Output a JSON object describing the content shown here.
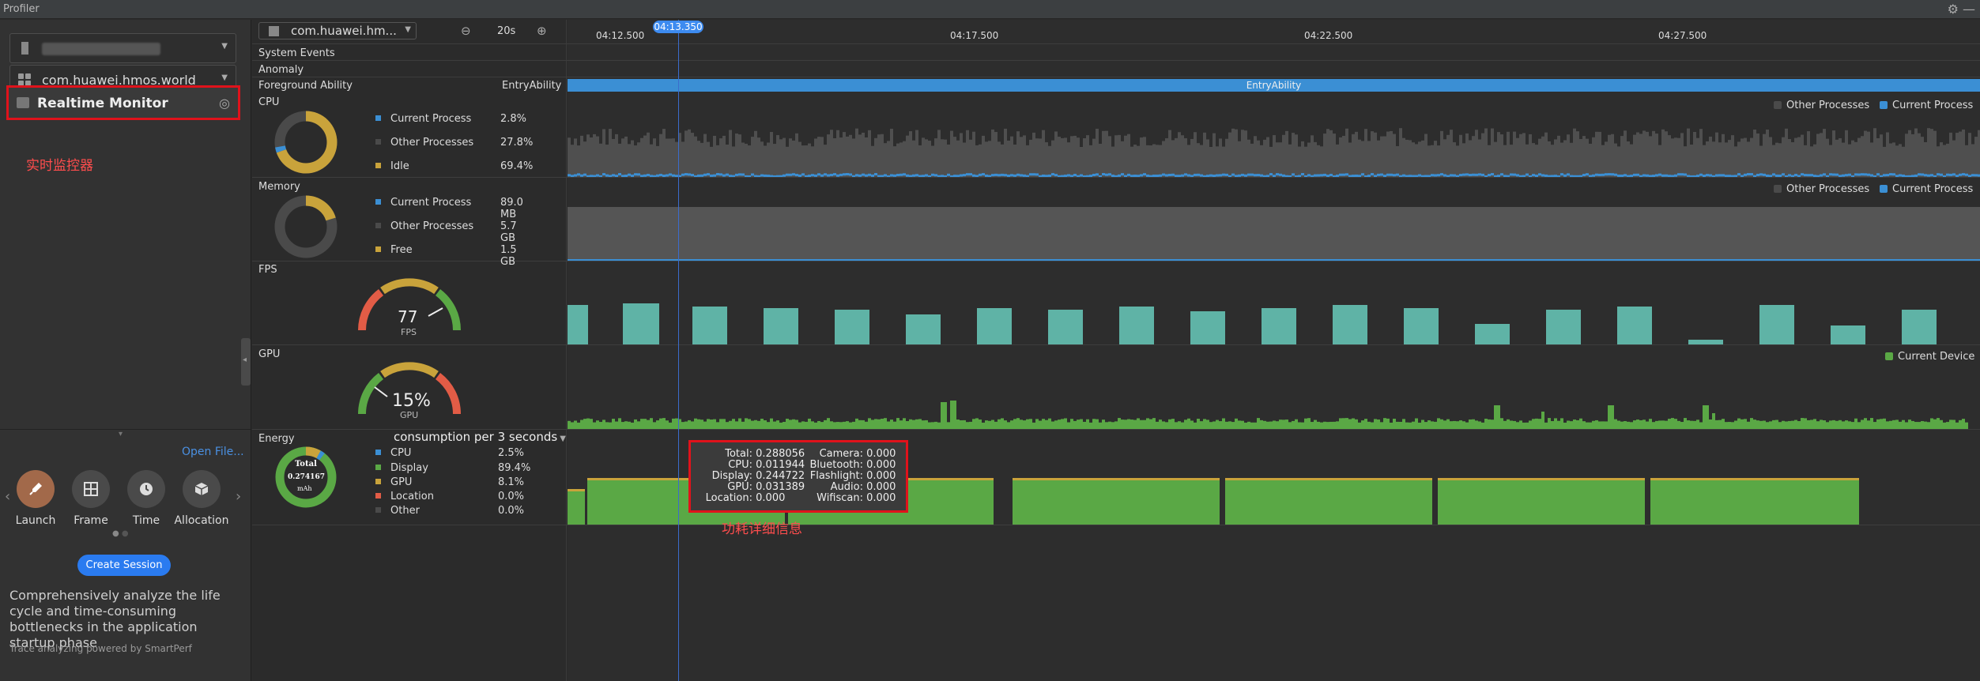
{
  "app": {
    "title": "Profiler"
  },
  "sidebar": {
    "device_select": {
      "value": ""
    },
    "app_select": {
      "value": "com.huawei.hmos.world"
    },
    "realtime_monitor": {
      "label": "Realtime Monitor"
    },
    "annotation_realtime": "实时监控器",
    "open_file": "Open File...",
    "tools": [
      {
        "label": "Launch",
        "icon": "rocket-icon"
      },
      {
        "label": "Frame",
        "icon": "frame-icon"
      },
      {
        "label": "Time",
        "icon": "clock-icon"
      },
      {
        "label": "Allocation",
        "icon": "cube-icon"
      }
    ],
    "create_session": "Create Session",
    "description": "Comprehensively analyze the life cycle and time-consuming bottlenecks in the application startup phase",
    "powered_by": "Trace analyzing powered by SmartPerf"
  },
  "toolbar": {
    "process_select": "com.huawei.hm...",
    "interval": "20s"
  },
  "timeline": {
    "cursor_time": "04:13.350",
    "ticks": [
      "04:12.500",
      "04:17.500",
      "04:22.500",
      "04:27.500"
    ]
  },
  "rows": {
    "system_events": "System Events",
    "anomaly": "Anomaly",
    "foreground_ability": "Foreground Ability",
    "foreground_ability_value": "EntryAbility",
    "foreground_band_label": "EntryAbility"
  },
  "cpu": {
    "title": "CPU",
    "legend": [
      {
        "name": "Current Process",
        "value": "2.8%",
        "color": "#3b8fd4"
      },
      {
        "name": "Other Processes",
        "value": "27.8%",
        "color": "#4a4a4a"
      },
      {
        "name": "Idle",
        "value": "69.4%",
        "color": "#c9a33b"
      }
    ],
    "top_legend": [
      {
        "name": "Other Processes",
        "color": "#4a4a4a"
      },
      {
        "name": "Current Process",
        "color": "#3b8fd4"
      }
    ]
  },
  "memory": {
    "title": "Memory",
    "legend": [
      {
        "name": "Current Process",
        "value": "89.0 MB",
        "color": "#3b8fd4"
      },
      {
        "name": "Other Processes",
        "value": "5.7 GB",
        "color": "#4a4a4a"
      },
      {
        "name": "Free",
        "value": "1.5 GB",
        "color": "#c9a33b"
      }
    ],
    "top_legend": [
      {
        "name": "Other Processes",
        "color": "#4a4a4a"
      },
      {
        "name": "Current Process",
        "color": "#3b8fd4"
      }
    ]
  },
  "fps": {
    "title": "FPS",
    "value": "77",
    "unit": "FPS",
    "gauge_fraction": 0.64
  },
  "gpu": {
    "title": "GPU",
    "value": "15%",
    "unit": "GPU",
    "gauge_fraction": 0.15,
    "top_legend": "Current Device"
  },
  "energy": {
    "title": "Energy",
    "mode": "consumption per 3 seconds",
    "donut_title": "Total",
    "donut_value": "0.274167",
    "donut_unit": "mAh",
    "legend": [
      {
        "name": "CPU",
        "value": "2.5%",
        "color": "#3b8fd4"
      },
      {
        "name": "Display",
        "value": "89.4%",
        "color": "#5aa845"
      },
      {
        "name": "GPU",
        "value": "8.1%",
        "color": "#c9a33b"
      },
      {
        "name": "Location",
        "value": "0.0%",
        "color": "#e25c46"
      },
      {
        "name": "Other",
        "value": "0.0%",
        "color": "#4a4a4a"
      }
    ],
    "tooltip": {
      "left": [
        {
          "k": "Total:",
          "v": "0.288056"
        },
        {
          "k": "CPU:",
          "v": "0.011944"
        },
        {
          "k": "Display:",
          "v": "0.244722"
        },
        {
          "k": "GPU:",
          "v": "0.031389"
        },
        {
          "k": "Location:",
          "v": "0.000"
        }
      ],
      "right": [
        {
          "k": "Camera:",
          "v": "0.000"
        },
        {
          "k": "Bluetooth:",
          "v": "0.000"
        },
        {
          "k": "Flashlight:",
          "v": "0.000"
        },
        {
          "k": "Audio:",
          "v": "0.000"
        },
        {
          "k": "Wifiscan:",
          "v": "0.000"
        }
      ]
    },
    "annotation_tooltip": "功耗详细信息"
  }
}
